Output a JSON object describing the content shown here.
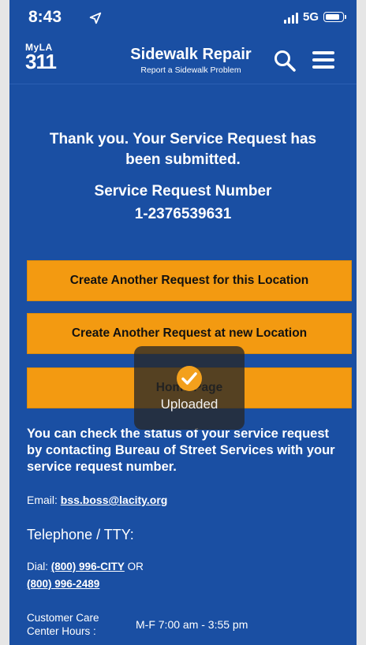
{
  "status_bar": {
    "time": "8:43",
    "network": "5G"
  },
  "header": {
    "logo_top": "MyLA",
    "logo_number": "311",
    "title": "Sidewalk Repair",
    "subtitle": "Report a Sidewalk Problem"
  },
  "confirmation": {
    "message": "Thank you. Your Service Request has been submitted.",
    "number_label": "Service Request Number",
    "number_value": "1-2376539631"
  },
  "buttons": {
    "same_location": "Create Another Request for this Location",
    "new_location": "Create Another Request at new Location",
    "home_page": "Home Page"
  },
  "toast": {
    "label": "Uploaded"
  },
  "contact": {
    "status_info": "You can check the status of your service request by contacting  Bureau of Street Services with your service request number.",
    "email_label": "Email:",
    "email_value": "bss.boss@lacity.org",
    "telephone_heading": "Telephone / TTY:",
    "dial_label": "Dial:",
    "phone_1": "(800) 996-CITY",
    "or_text": "OR",
    "phone_2": "(800) 996-2489",
    "hours_label": "Customer Care Center Hours :",
    "hours_value": "M-F 7:00 am - 3:55 pm"
  },
  "colors": {
    "background": "#1a4fa3",
    "button": "#f39a11",
    "text": "#ffffff"
  },
  "icons": {
    "status_location": "location-arrow-icon",
    "search": "search-icon",
    "menu": "hamburger-menu-icon",
    "toast": "checkmark-icon"
  }
}
